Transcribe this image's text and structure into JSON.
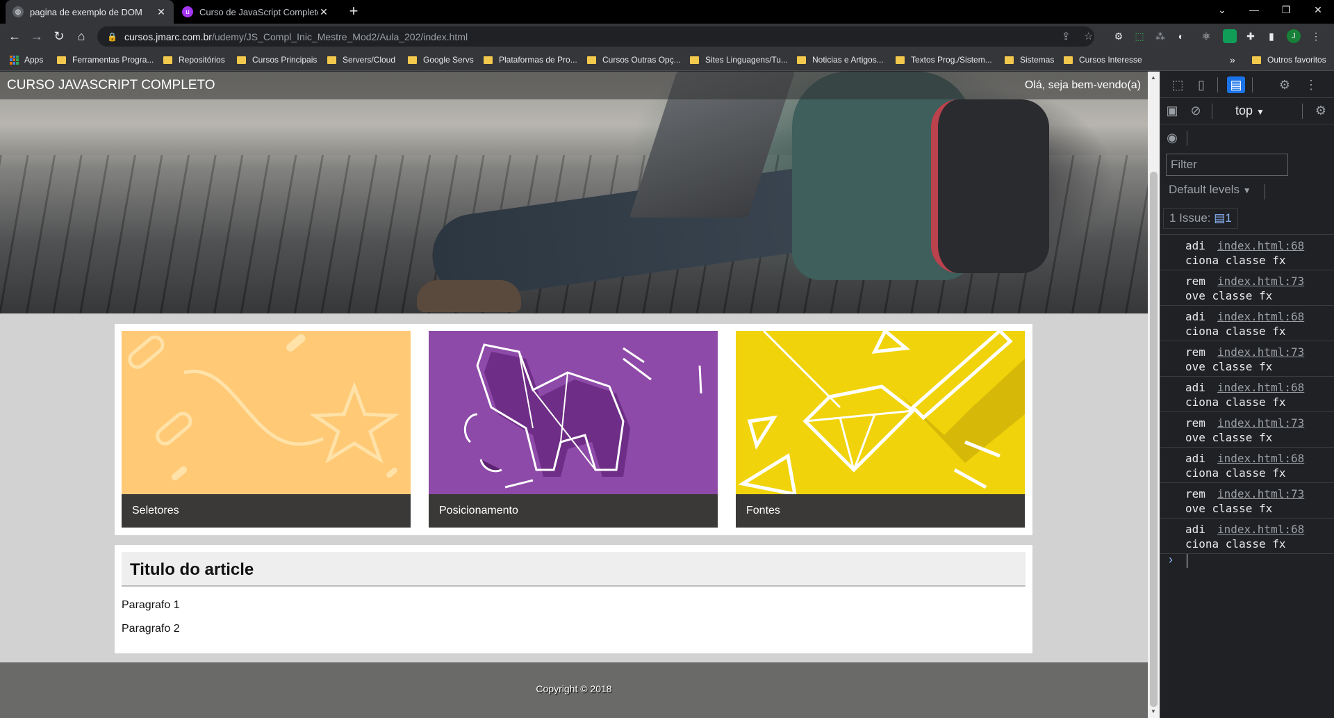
{
  "tabs": [
    {
      "title": "pagina de exemplo de DOM",
      "active": true
    },
    {
      "title": "Curso de JavaScript Completo do",
      "active": false
    }
  ],
  "address": {
    "host": "cursos.jmarc.com.br",
    "path": "/udemy/JS_Compl_Inic_Mestre_Mod2/Aula_202/index.html"
  },
  "profile_initial": "J",
  "bookmarks": [
    "Apps",
    "Ferramentas Progra...",
    "Repositórios",
    "Cursos Principais",
    "Servers/Cloud",
    "Google Servs",
    "Plataformas de Pro...",
    "Cursos Outras Opç...",
    "Sites Linguagens/Tu...",
    "Noticias e Artigos...",
    "Textos Prog./Sistem...",
    "Sistemas",
    "Cursos Interesse"
  ],
  "bookmarks_overflow": "»",
  "bookmarks_other": "Outros favoritos",
  "page": {
    "header_title": "CURSO JAVASCRIPT COMPLETO",
    "greeting": "Olá, seja bem-vendo(a)",
    "cards": [
      {
        "caption": "Seletores",
        "color": "#ffc976"
      },
      {
        "caption": "Posicionamento",
        "color": "#8e4aa8"
      },
      {
        "caption": "Fontes",
        "color": "#f0d30a"
      }
    ],
    "article_title": "Titulo do article",
    "paragraphs": [
      "Paragrafo 1",
      "Paragrafo 2"
    ],
    "copyright": "Copyright © 2018"
  },
  "devtools": {
    "context": "top",
    "filter_placeholder": "Filter",
    "levels": "Default levels",
    "issues_label": "1 Issue:",
    "issues_count": "1",
    "logs": [
      {
        "a": "adi",
        "src": "index.html:68",
        "b": "ciona classe fx"
      },
      {
        "a": "rem",
        "src": "index.html:73",
        "b": "ove classe fx"
      },
      {
        "a": "adi",
        "src": "index.html:68",
        "b": "ciona classe fx"
      },
      {
        "a": "rem",
        "src": "index.html:73",
        "b": "ove classe fx"
      },
      {
        "a": "adi",
        "src": "index.html:68",
        "b": "ciona classe fx"
      },
      {
        "a": "rem",
        "src": "index.html:73",
        "b": "ove classe fx"
      },
      {
        "a": "adi",
        "src": "index.html:68",
        "b": "ciona classe fx"
      },
      {
        "a": "rem",
        "src": "index.html:73",
        "b": "ove classe fx"
      },
      {
        "a": "adi",
        "src": "index.html:68",
        "b": "ciona classe fx"
      }
    ]
  }
}
